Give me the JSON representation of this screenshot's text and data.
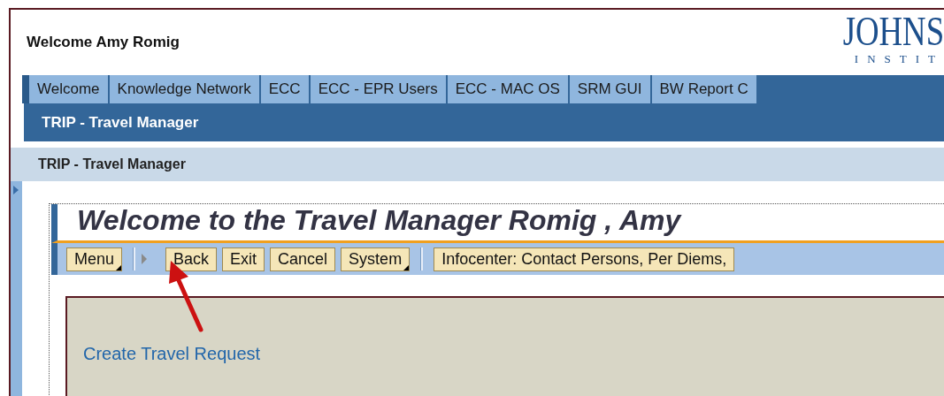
{
  "header": {
    "greeting": "Welcome Amy Romig",
    "logo": {
      "name": "JOHNS",
      "subtitle": "INSTIT"
    }
  },
  "tabs": [
    {
      "label": "Welcome",
      "selected": false
    },
    {
      "label": "Knowledge Network",
      "selected": false
    },
    {
      "label": "ECC",
      "selected": false
    },
    {
      "label": "ECC - EPR Users",
      "selected": false
    },
    {
      "label": "ECC - MAC OS",
      "selected": false
    },
    {
      "label": "SRM GUI",
      "selected": false
    },
    {
      "label": "BW Report C",
      "selected": false
    }
  ],
  "subnav": {
    "label": "TRIP - Travel Manager"
  },
  "page_title": "TRIP - Travel Manager",
  "app": {
    "heading": "Welcome to the Travel Manager Romig , Amy",
    "toolbar_groups": [
      [
        {
          "label": "Menu",
          "has_menu": true
        }
      ],
      [
        {
          "label": "Back",
          "has_menu": false
        },
        {
          "label": "Exit",
          "has_menu": false
        },
        {
          "label": "Cancel",
          "has_menu": false
        },
        {
          "label": "System",
          "has_menu": true
        }
      ],
      [
        {
          "label": "Infocenter: Contact Persons, Per Diems,",
          "has_menu": false
        }
      ]
    ],
    "links": [
      "Create Travel Request"
    ]
  }
}
